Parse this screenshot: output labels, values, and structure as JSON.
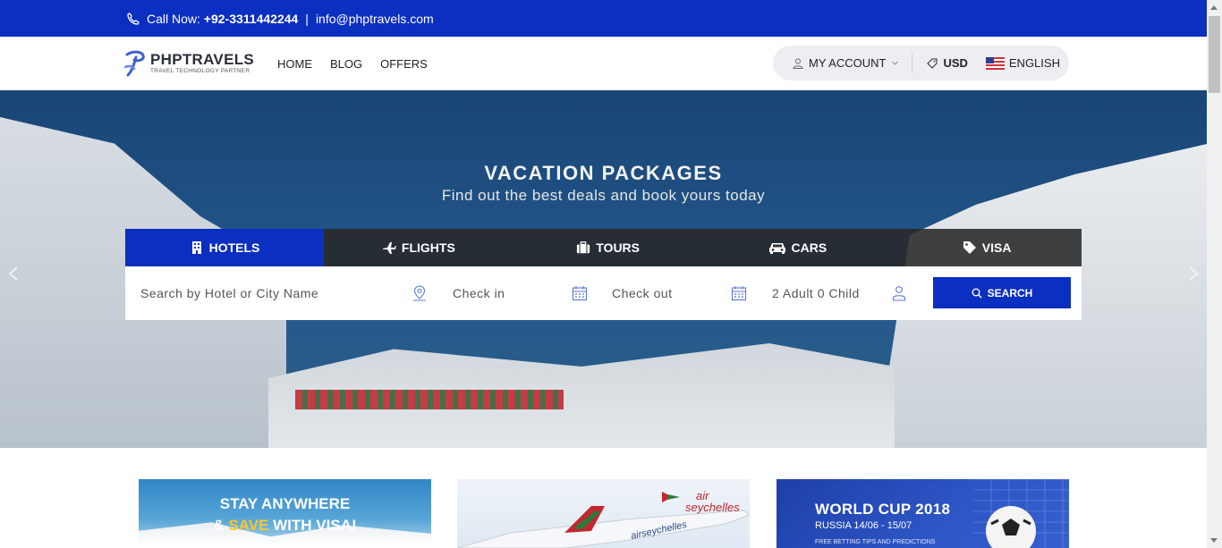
{
  "topbar": {
    "call_label": "Call Now:",
    "phone": "+92-3311442244",
    "separator": "|",
    "email": "info@phptravels.com"
  },
  "header": {
    "logo_name": "PHPTRAVELS",
    "logo_tagline": "TRAVEL TECHNOLOGY PARTNER",
    "nav": [
      "HOME",
      "BLOG",
      "OFFERS"
    ],
    "account_label": "MY ACCOUNT",
    "currency": "USD",
    "language": "ENGLISH"
  },
  "hero": {
    "title": "VACATION PACKAGES",
    "subtitle": "Find out the best deals and book yours today"
  },
  "tabs": [
    {
      "label": "HOTELS",
      "icon": "hotel-icon",
      "active": true
    },
    {
      "label": "FLIGHTS",
      "icon": "plane-icon",
      "active": false
    },
    {
      "label": "TOURS",
      "icon": "suitcase-icon",
      "active": false
    },
    {
      "label": "CARS",
      "icon": "car-icon",
      "active": false
    },
    {
      "label": "VISA",
      "icon": "tag-icon",
      "active": false
    }
  ],
  "search": {
    "destination_placeholder": "Search by Hotel or City Name",
    "checkin_placeholder": "Check in",
    "checkout_placeholder": "Check out",
    "guests": "2 Adult 0 Child",
    "button_label": "SEARCH"
  },
  "promos": [
    {
      "line1": "STAY ANYWHERE",
      "line2_a": "&",
      "line2_b": "SAVE",
      "line2_c": "WITH VISA!"
    },
    {
      "brand_a": "air",
      "brand_b": "seychelles",
      "plane_text": "airseychelles"
    },
    {
      "title": "WORLD CUP 2018",
      "subtitle": "RUSSIA 14/06 - 15/07",
      "footer": "FREE BETTING TIPS AND PREDICTIONS"
    }
  ],
  "colors": {
    "brand_blue": "#0b2fc0",
    "tab_dark": "#282828"
  }
}
